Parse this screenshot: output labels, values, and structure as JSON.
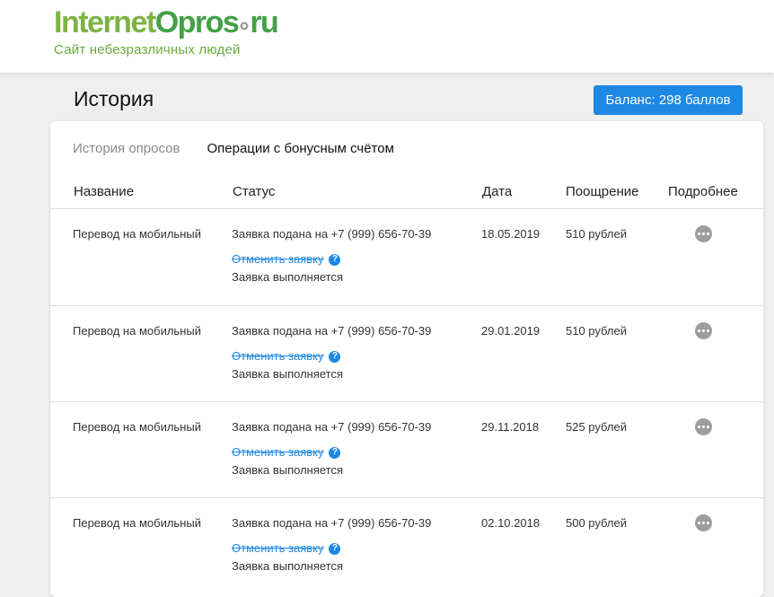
{
  "logo": {
    "part1": "Internet",
    "part2": "Opros",
    "part3": "ru",
    "tagline": "Сайт небезразличных людей"
  },
  "page": {
    "title": "История",
    "balance_label": "Баланс: 298 баллов"
  },
  "tabs": [
    {
      "label": "История опросов",
      "active": false
    },
    {
      "label": "Операции с бонусным счётом",
      "active": true
    }
  ],
  "table": {
    "headers": {
      "name": "Название",
      "status": "Статус",
      "date": "Дата",
      "reward": "Поощрение",
      "details": "Подробнее"
    },
    "rows": [
      {
        "name": "Перевод на мобильный",
        "status": "Заявка подана на +7 (999) 656-70-39",
        "cancel": "Отменить заявку",
        "state": "Заявка выполняется",
        "date": "18.05.2019",
        "reward": "510 рублей"
      },
      {
        "name": "Перевод на мобильный",
        "status": "Заявка подана на +7 (999) 656-70-39",
        "cancel": "Отменить заявку",
        "state": "Заявка выполняется",
        "date": "29.01.2019",
        "reward": "510 рублей"
      },
      {
        "name": "Перевод на мобильный",
        "status": "Заявка подана на +7 (999) 656-70-39",
        "cancel": "Отменить заявку",
        "state": "Заявка выполняется",
        "date": "29.11.2018",
        "reward": "525 рублей"
      },
      {
        "name": "Перевод на мобильный",
        "status": "Заявка подана на +7 (999) 656-70-39",
        "cancel": "Отменить заявку",
        "state": "Заявка выполняется",
        "date": "02.10.2018",
        "reward": "500 рублей"
      }
    ]
  },
  "icons": {
    "help": "question-circle-icon",
    "more": "more-dots-icon"
  },
  "colors": {
    "brand_green": "#43a047",
    "brand_light_green": "#7cb342",
    "accent_blue": "#1e88e5"
  }
}
